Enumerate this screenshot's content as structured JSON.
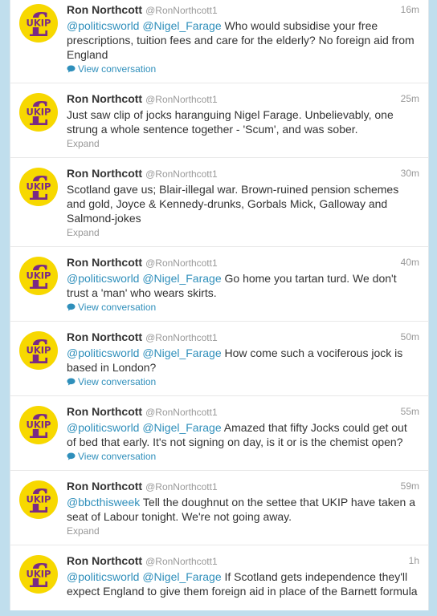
{
  "colors": {
    "background": "#c0deed",
    "link": "#2f8fbb",
    "meta": "#999999",
    "text": "#333333",
    "logo_purple": "#7a2a85",
    "logo_yellow": "#f7d800"
  },
  "icons": {
    "avatar": "ukip-logo-avatar",
    "conversation": "speech-bubble-icon"
  },
  "tweets": [
    {
      "name": "Ron Northcott",
      "handle": "@RonNorthcott1",
      "time": "16m",
      "mentions": "@politicsworld @Nigel_Farage",
      "body": " Who would subsidise your free prescriptions, tuition fees and care for the elderly? No foreign aid from England",
      "action": "View conversation",
      "action_type": "conversation"
    },
    {
      "name": "Ron Northcott",
      "handle": "@RonNorthcott1",
      "time": "25m",
      "mentions": "",
      "body": "Just saw clip of jocks haranguing Nigel Farage. Unbelievably, one strung a whole sentence together - 'Scum', and was sober.",
      "action": "Expand",
      "action_type": "expand"
    },
    {
      "name": "Ron Northcott",
      "handle": "@RonNorthcott1",
      "time": "30m",
      "mentions": "",
      "body": "Scotland gave us; Blair-illegal war. Brown-ruined pension schemes and gold, Joyce & Kennedy-drunks, Gorbals Mick, Galloway and Salmond-jokes",
      "action": "Expand",
      "action_type": "expand"
    },
    {
      "name": "Ron Northcott",
      "handle": "@RonNorthcott1",
      "time": "40m",
      "mentions": "@politicsworld @Nigel_Farage",
      "body": " Go home you tartan turd. We don't trust a 'man' who wears skirts.",
      "action": "View conversation",
      "action_type": "conversation"
    },
    {
      "name": "Ron Northcott",
      "handle": "@RonNorthcott1",
      "time": "50m",
      "mentions": "@politicsworld @Nigel_Farage",
      "body": " How come such a vociferous jock is based in London?",
      "action": "View conversation",
      "action_type": "conversation"
    },
    {
      "name": "Ron Northcott",
      "handle": "@RonNorthcott1",
      "time": "55m",
      "mentions": "@politicsworld @Nigel_Farage",
      "body": " Amazed that fifty Jocks could get out of bed that early. It's not signing on day, is it or is the chemist open?",
      "action": "View conversation",
      "action_type": "conversation"
    },
    {
      "name": "Ron Northcott",
      "handle": "@RonNorthcott1",
      "time": "59m",
      "mentions": "@bbcthisweek",
      "body": " Tell the doughnut on the settee that UKIP have taken a seat of Labour tonight. We're not going away.",
      "action": "Expand",
      "action_type": "expand"
    },
    {
      "name": "Ron Northcott",
      "handle": "@RonNorthcott1",
      "time": "1h",
      "mentions": "@politicsworld @Nigel_Farage",
      "body": " If Scotland gets independence they'll expect England to give them foreign aid in place of the Barnett formula",
      "action": "",
      "action_type": "none"
    }
  ]
}
